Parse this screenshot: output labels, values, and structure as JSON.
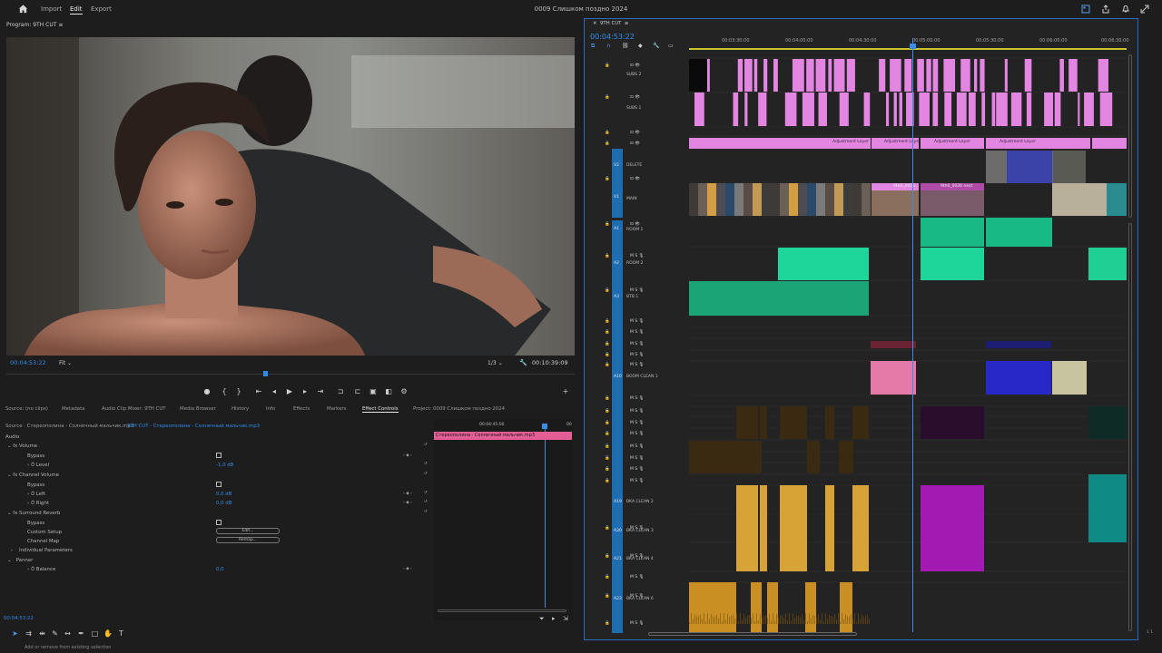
{
  "topbar": {
    "menu": [
      "Import",
      "Edit",
      "Export"
    ],
    "active_menu": "Edit",
    "project_title": "0009 Слишком поздно 2024"
  },
  "program": {
    "label": "Program: 9TH CUT",
    "timecode_current": "00:04:53:22",
    "fit": "Fit",
    "resolution": "1/3",
    "timecode_duration": "00:10:39:09"
  },
  "panel_tabs": [
    "Source: (no clips)",
    "Metadata",
    "Audio Clip Mixer: 9TH CUT",
    "Media Browser",
    "History",
    "Info",
    "Effects",
    "Markers",
    "Effect Controls",
    "Project: 0009 Слишком поздно 2024"
  ],
  "active_panel_tab": "Effect Controls",
  "effect_controls": {
    "source_path": "Source · Стереополина - Солнечный мальчик.mp3",
    "sequence_path": "9TH CUT · Стереополина - Солнечный мальчик.mp3",
    "mini_timecode": "00:04:45:00",
    "mini_tc_end": "00",
    "clip_name": "Стереополина - Солнечный мальчик.mp3",
    "section": "Audio",
    "volume": "Volume",
    "bypass": "Bypass",
    "level": "Level",
    "level_value": "-1,0 dB",
    "channel_volume": "Channel Volume",
    "bypass2": "Bypass",
    "left": "Left",
    "left_value": "0,0 dB",
    "right": "Right",
    "right_value": "0,0 dB",
    "surround_reverb": "Surround Reverb",
    "bypass3": "Bypass",
    "custom_setup": "Custom Setup",
    "custom_setup_btn": "Edit...",
    "channel_map": "Channel Map",
    "channel_map_btn": "Remap...",
    "individual_params": "Individual Parameters",
    "panner": "Panner",
    "balance": "Balance",
    "balance_value": "0,0",
    "bottom_timecode": "00:04:53:22"
  },
  "status_text": "Add or remove from existing selection",
  "timeline": {
    "tab": "9TH CUT",
    "timecode": "00:04:53:22",
    "ruler": [
      "00:03:30:00",
      "00:04:00:00",
      "00:04:30:00",
      "00:05:00:00",
      "00:05:30:00",
      "00:06:00:00",
      "00:06:30:00"
    ],
    "tracks_video": [
      {
        "id": "V8",
        "name": "SUBS 2"
      },
      {
        "id": "V5",
        "name": "SUBS 1"
      },
      {
        "id": "V4",
        "name": ""
      },
      {
        "id": "V3",
        "name": ""
      },
      {
        "id": "V2",
        "name": "DELETE"
      },
      {
        "id": "V1",
        "name": "MAIN"
      }
    ],
    "tracks_audio": [
      {
        "id": "A1",
        "name": "ROOM 1"
      },
      {
        "id": "A2",
        "name": "ROOM 2"
      },
      {
        "id": "A3",
        "name": "BTB 1"
      },
      {
        "id": "A4",
        "name": ""
      },
      {
        "id": "A5",
        "name": ""
      },
      {
        "id": "A6",
        "name": ""
      },
      {
        "id": "A7",
        "name": ""
      },
      {
        "id": "A10",
        "name": "BOOM CLEAN 1"
      },
      {
        "id": "A11",
        "name": ""
      },
      {
        "id": "A12",
        "name": ""
      },
      {
        "id": "A13",
        "name": ""
      },
      {
        "id": "A14",
        "name": ""
      },
      {
        "id": "A15",
        "name": ""
      },
      {
        "id": "A16",
        "name": ""
      },
      {
        "id": "A17",
        "name": ""
      },
      {
        "id": "A18",
        "name": ""
      },
      {
        "id": "A19",
        "name": "BKA CLEAN 2"
      },
      {
        "id": "A20",
        "name": "BKA CLEAN 3"
      },
      {
        "id": "A21",
        "name": "BKA CLEAN 4"
      },
      {
        "id": "A22",
        "name": ""
      },
      {
        "id": "A23",
        "name": "BKA CLEAN 6"
      }
    ],
    "adjustment_label": "Adjustment Layer",
    "clip_text_main": "9th0_0026",
    "clip_text_main2": "9th0_0026 nest",
    "page_indicator": "1 1"
  },
  "colors": {
    "accent": "#2d8ceb",
    "subs": "#e286e2",
    "adj": "#e286e2",
    "audio_green": "#1fd69a",
    "audio_teal": "#1ba577",
    "pink_audio": "#e57aa8",
    "blue_audio": "#2828c8",
    "gold_audio": "#d7a336",
    "purple_audio": "#a21ab1",
    "teal_audio": "#0f8a84"
  }
}
